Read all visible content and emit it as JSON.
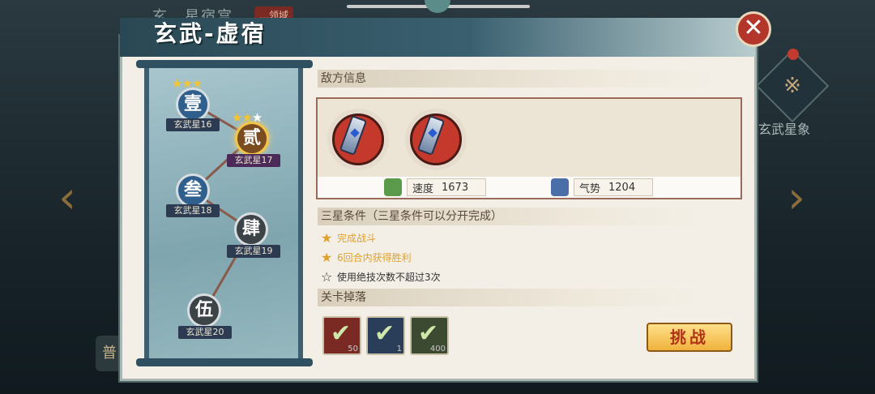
{
  "background": {
    "title": "玄…星宿宫",
    "badge": "…领域",
    "star_map_label": "玄武星象",
    "bottom_button": "普"
  },
  "dialog": {
    "title": "玄武-虚宿",
    "close_icon": "close-icon"
  },
  "stage_map": {
    "nodes": [
      {
        "char": "壹",
        "label": "玄武星16",
        "stars_earned": 3,
        "stars_total": 3,
        "state": "cleared"
      },
      {
        "char": "贰",
        "label": "玄武星17",
        "stars_earned": 2,
        "stars_total": 3,
        "state": "selected"
      },
      {
        "char": "叁",
        "label": "玄武星18",
        "stars_earned": 0,
        "stars_total": 3,
        "state": "cleared"
      },
      {
        "char": "肆",
        "label": "玄武星19",
        "stars_earned": 0,
        "stars_total": 3,
        "state": "locked"
      },
      {
        "char": "伍",
        "label": "玄武星20",
        "stars_earned": 0,
        "stars_total": 3,
        "state": "locked"
      }
    ]
  },
  "enemy_info": {
    "heading": "敌方信息",
    "enemies": [
      {
        "icon": "enemy-weapon-icon"
      },
      {
        "icon": "enemy-weapon-icon"
      }
    ],
    "stats": [
      {
        "label": "速度",
        "value": "1673",
        "icon": "speed-icon",
        "color": "#5a9a4a"
      },
      {
        "label": "气势",
        "value": "1204",
        "icon": "momentum-icon",
        "color": "#4a6fa8"
      }
    ]
  },
  "three_star": {
    "heading": "三星条件（三星条件可以分开完成）",
    "conditions": [
      {
        "text": "完成战斗",
        "done": true
      },
      {
        "text": "6回合内获得胜利",
        "done": true
      },
      {
        "text": "使用绝技次数不超过3次",
        "done": false
      }
    ]
  },
  "drops": {
    "heading": "关卡掉落",
    "items": [
      {
        "count": "50",
        "color": "#7a2a22"
      },
      {
        "count": "1",
        "color": "#2a3e5a"
      },
      {
        "count": "400",
        "color": "#3d4a32"
      }
    ]
  },
  "actions": {
    "challenge": "挑战"
  }
}
